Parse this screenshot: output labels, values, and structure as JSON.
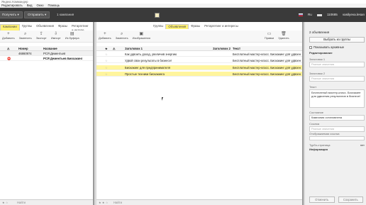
{
  "window": {
    "title": "Яндекс.Коммандер"
  },
  "menu": [
    "Редактировать",
    "Вид",
    "Окно",
    "Помощь"
  ],
  "toolbar": {
    "get_button": "Получить ▾",
    "send_button": "Отправить ▾",
    "campaign_count": "1 кампания",
    "region": "Ru",
    "balance": "110685",
    "login": "vasilyeva.lesan"
  },
  "left": {
    "tabs": [
      "Кампании",
      "Группы",
      "Объявления",
      "Фразы",
      "Ретаргетинг и интере"
    ],
    "actions": [
      "Добавить",
      "Заменить",
      "Экспорт",
      "Импорт",
      "Из буфера"
    ],
    "columns": [
      "Номер",
      "Название"
    ],
    "rows": [
      {
        "number": "46860974",
        "name": "РСЯ Дементьев"
      },
      {
        "number": "",
        "name": "РСЯ Дементьев Биохакинг"
      }
    ],
    "filter_placeholder": "Найти"
  },
  "middle": {
    "tabs": [
      "Группы",
      "Объявления",
      "Фразы",
      "Ретаргетинг и интересы"
    ],
    "actions": [
      "Добавить",
      "Заменить",
      "Изображения",
      "Правки",
      "Удалить"
    ],
    "columns": [
      "Заголовок 1",
      "Заголовок 2",
      "Текст"
    ],
    "rows": [
      {
        "title": "Как удвоить доход, увеличив энергию",
        "text": "Бесплатный мастер-класс. Биохакинг для удвоен"
      },
      {
        "title": "Удвой свои результаты в бизнесе!",
        "text": "Бесплатный мастер-класс. Биохакинг для удвоен"
      },
      {
        "title": "Биохакинг для предпринимателя",
        "text": "Бесплатный мастер-класс. Биохакинг для удвоен"
      },
      {
        "title": "Простые техники биохакинга",
        "text": "Бесплатный мастер-класс. Биохакинг для удвоен"
      }
    ],
    "filter_placeholder": "Найти"
  },
  "right": {
    "header": "2 объявления",
    "select_group_button": "Выбрать из группы",
    "show_archived": "Показывать архивные",
    "editing_label": "Редактирование",
    "title1_label": "Заголовок 1",
    "title1_placeholder": "Разные значения",
    "title2_label": "Заголовок 2",
    "title2_placeholder": "Разные значения",
    "text_label": "Текст",
    "text_value": "Бесплатный мастер-класс. Биохакинг для удвоения результатов в бизнесе!",
    "status_label": "Состояние",
    "status_value": "Кампания остановлена",
    "link_label": "Ссылка",
    "link_placeholder": "Разные значения",
    "display_link_label": "Отображаемая ссылка",
    "turbo_label": "Турбо-страница",
    "turbo_value": "нет",
    "info_label": "Информация",
    "cancel_button": "Отменить",
    "save_button": "Сохранить"
  },
  "colors": {
    "toolbar": "#3a3a3a",
    "highlight": "#fff59d",
    "active_tab": "#fff176"
  }
}
